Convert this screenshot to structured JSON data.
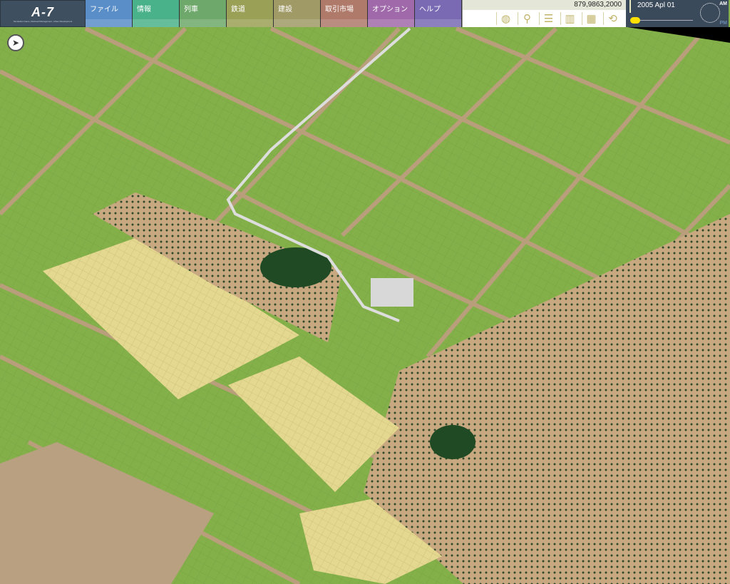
{
  "logo": {
    "text": "A-7",
    "subtitle": "Simulation Game, Railroad Management, Urban Development"
  },
  "menu": [
    {
      "label": "ファイル",
      "color": "#5a8ec8"
    },
    {
      "label": "情報",
      "color": "#4ab28a"
    },
    {
      "label": "列車",
      "color": "#6ea86a"
    },
    {
      "label": "鉄道",
      "color": "#9aa056"
    },
    {
      "label": "建設",
      "color": "#a09a66"
    },
    {
      "label": "取引市場",
      "color": "#b07a6a"
    },
    {
      "label": "オプション",
      "color": "#a06aaa"
    },
    {
      "label": "ヘルプ",
      "color": "#7a6ab4"
    }
  ],
  "status": {
    "money": "879,9863,2000"
  },
  "tools": [
    "planet-icon",
    "zoom-icon",
    "layers-icon",
    "buildings-icon",
    "grid-icon",
    "rotate-icon"
  ],
  "clock": {
    "date": "2005 Apl  01",
    "am": "AM",
    "pm": "PM",
    "speed": 0.05
  }
}
